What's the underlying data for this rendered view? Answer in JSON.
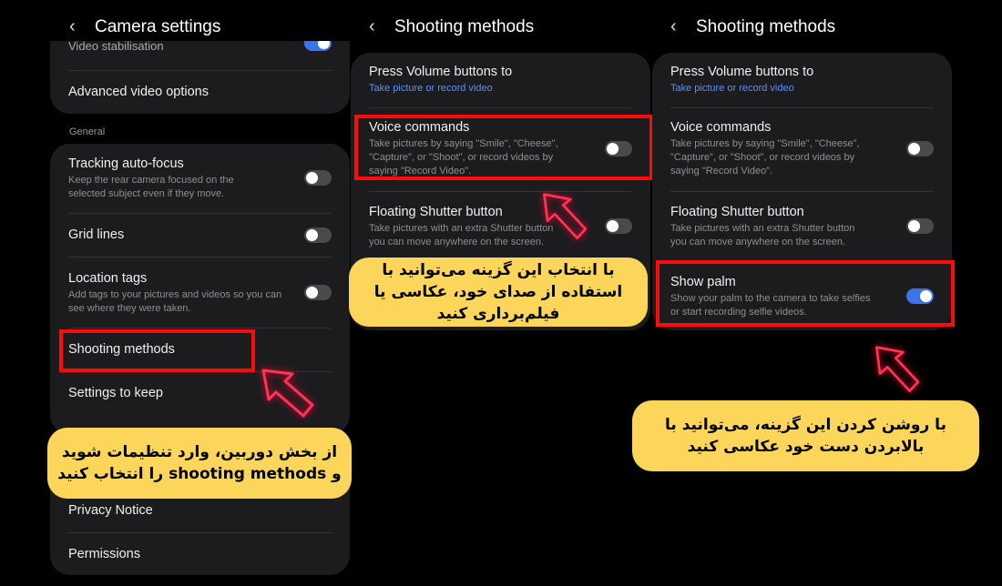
{
  "left": {
    "header": {
      "title": "Camera settings"
    },
    "video_stabilisation": {
      "label": "Video stabilisation",
      "on": true
    },
    "advanced_video": "Advanced video options",
    "section_general": "General",
    "tracking": {
      "title": "Tracking auto-focus",
      "desc": "Keep the rear camera focused on the selected subject even if they move.",
      "on": false
    },
    "grid_lines": {
      "title": "Grid lines",
      "on": false
    },
    "location_tags": {
      "title": "Location tags",
      "desc": "Add tags to your pictures and videos so you can see where they were taken.",
      "on": false
    },
    "shooting_methods": "Shooting methods",
    "settings_to_keep": "Settings to keep",
    "privacy_notice": "Privacy Notice",
    "permissions": "Permissions",
    "callout": "از بخش دوربین، وارد تنظیمات شوید و shooting methods را انتخاب کنید"
  },
  "middle": {
    "header": {
      "title": "Shooting methods"
    },
    "press_volume": {
      "title": "Press Volume buttons to",
      "value": "Take picture or record video"
    },
    "voice_commands": {
      "title": "Voice commands",
      "desc": "Take pictures by saying \"Smile\", \"Cheese\", \"Capture\", or \"Shoot\", or record videos by saying \"Record Video\".",
      "on": false
    },
    "floating_shutter": {
      "title": "Floating Shutter button",
      "desc": "Take pictures with an extra Shutter button you can move anywhere on the screen.",
      "on": false
    },
    "callout": "با انتخاب این گزینه می‌توانید با استفاده از صدای خود، عکاسی یا فیلم‌برداری کنید"
  },
  "right": {
    "header": {
      "title": "Shooting methods"
    },
    "press_volume": {
      "title": "Press Volume buttons to",
      "value": "Take picture or record video"
    },
    "voice_commands": {
      "title": "Voice commands",
      "desc": "Take pictures by saying \"Smile\", \"Cheese\", \"Capture\", or \"Shoot\", or record videos by saying \"Record Video\".",
      "on": false
    },
    "floating_shutter": {
      "title": "Floating Shutter button",
      "desc": "Take pictures with an extra Shutter button you can move anywhere on the screen.",
      "on": false
    },
    "show_palm": {
      "title": "Show palm",
      "desc": "Show your palm to the camera to take selfies or start recording selfie videos.",
      "on": true
    },
    "callout": "با روشن کردن این گزینه، می‌توانید با بالابردن دست خود عکاسی کنید"
  },
  "colors": {
    "highlight": "#ff0b0b",
    "callout": "#fbd65a",
    "toggle_on": "#3b74e8",
    "link": "#5e8ff0",
    "arrow": "#ff3355"
  }
}
